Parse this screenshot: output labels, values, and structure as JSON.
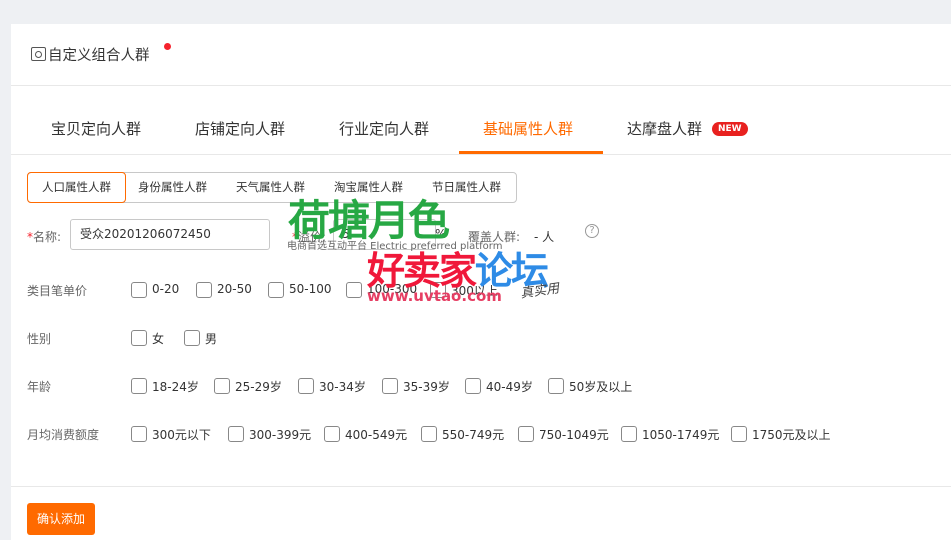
{
  "header": {
    "title": "自定义组合人群"
  },
  "tabs": [
    {
      "label": "宝贝定向人群"
    },
    {
      "label": "店铺定向人群"
    },
    {
      "label": "行业定向人群"
    },
    {
      "label": "基础属性人群"
    },
    {
      "label": "达摩盘人群"
    }
  ],
  "new_badge": "NEW",
  "subtabs": [
    {
      "label": "人口属性人群"
    },
    {
      "label": "身份属性人群"
    },
    {
      "label": "天气属性人群"
    },
    {
      "label": "淘宝属性人群"
    },
    {
      "label": "节日属性人群"
    }
  ],
  "form": {
    "name_required_mark": "*",
    "name_label": "名称:",
    "name_value": "受众20201206072450",
    "premium_required_mark": "*",
    "premium_label": "溢价:",
    "premium_value": "5",
    "percent": "%",
    "coverage_label": "覆盖人群:",
    "coverage_value": "- 人",
    "help": "?"
  },
  "groups": {
    "price": {
      "label": "类目笔单价",
      "options": [
        "0-20",
        "20-50",
        "50-100",
        "100-300",
        "300以上"
      ]
    },
    "gender": {
      "label": "性别",
      "options": [
        "女",
        "男"
      ]
    },
    "age": {
      "label": "年龄",
      "options": [
        "18-24岁",
        "25-29岁",
        "30-34岁",
        "35-39岁",
        "40-49岁",
        "50岁及以上"
      ]
    },
    "spend": {
      "label": "月均消费额度",
      "options": [
        "300元以下",
        "300-399元",
        "400-549元",
        "550-749元",
        "750-1049元",
        "1050-1749元",
        "1750元及以上"
      ]
    }
  },
  "confirm_button": "确认添加",
  "watermark": {
    "brand": "荷塘月色",
    "brand_sub": "电商首选互动平台 Electric preferred platform",
    "forum_red": "好卖家",
    "forum_blue": "论坛",
    "url": "www.uvtao.com",
    "slogan": "真实用"
  },
  "colors": {
    "accent": "#ff6a00",
    "badge": "#e8211f",
    "required": "#f5222d"
  }
}
